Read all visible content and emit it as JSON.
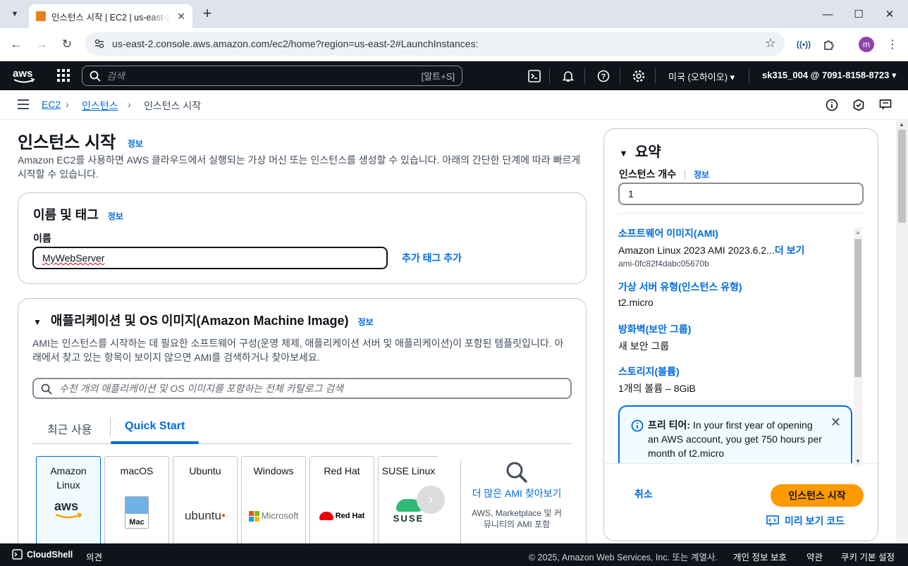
{
  "browser": {
    "tab_title": "인스턴스 시작 | EC2 | us-east-2",
    "url": "us-east-2.console.aws.amazon.com/ec2/home?region=us-east-2#LaunchInstances:",
    "profile_initial": "m"
  },
  "aws_nav": {
    "search_placeholder": "검색",
    "search_shortcut": "[알트+S]",
    "region": "미국 (오하이오) ▾",
    "account": "sk315_004 @ 7091-8158-8723 ▾"
  },
  "breadcrumb": {
    "items": [
      "EC2",
      "인스턴스",
      "인스턴스 시작"
    ]
  },
  "page": {
    "title": "인스턴스 시작",
    "info": "정보",
    "description": "Amazon EC2를 사용하면 AWS 클라우드에서 실행되는 가상 머신 또는 인스턴스를 생성할 수 있습니다. 아래의 간단한 단계에 따라 빠르게 시작할 수 있습니다."
  },
  "name_card": {
    "title": "이름 및 태그",
    "info": "정보",
    "label": "이름",
    "value": "MyWebServer",
    "add_tags": "추가 태그 추가"
  },
  "ami_card": {
    "title": "애플리케이션 및 OS 이미지(Amazon Machine Image)",
    "info": "정보",
    "description": "AMI는 인스턴스를 시작하는 데 필요한 소프트웨어 구성(운영 체제, 애플리케이션 서버 및 애플리케이션)이 포함된 템플릿입니다. 아래에서 찾고 있는 항목이 보이지 않으면 AMI를 검색하거나 찾아보세요.",
    "search_placeholder": "수천 개의 애플리케이션 및 OS 이미지를 포함하는 전체 카탈로그 검색",
    "tabs": [
      "최근 사용",
      "Quick Start"
    ],
    "os_tiles": [
      {
        "label": "Amazon Linux",
        "logo": "aws"
      },
      {
        "label": "macOS",
        "logo": "Mac"
      },
      {
        "label": "Ubuntu",
        "logo": "ubuntu"
      },
      {
        "label": "Windows",
        "logo": "Microsoft"
      },
      {
        "label": "Red Hat",
        "logo": "Red Hat"
      },
      {
        "label": "SUSE Linux",
        "logo": "SUSE"
      }
    ],
    "browse_more": "더 많은 AMI 찾아보기",
    "browse_sub": "AWS, Marketplace 및 커뮤니티의 AMI 포함"
  },
  "summary": {
    "title": "요약",
    "count_label": "인스턴스 개수",
    "info": "정보",
    "count_value": "1",
    "ami_title": "소프트웨어 이미지(AMI)",
    "ami_value": "Amazon Linux 2023 AMI 2023.6.2...",
    "ami_more": "더 보기",
    "ami_id": "ami-0fc82f4dabc05670b",
    "type_title": "가상 서버 유형(인스턴스 유형)",
    "type_value": "t2.micro",
    "fw_title": "방화벽(보안 그룹)",
    "fw_value": "새 보안 그룹",
    "storage_title": "스토리지(볼륨)",
    "storage_value": "1개의 볼륨 – 8GiB",
    "free_tier_label": "프리 티어:",
    "free_tier_text": "In your first year of opening an AWS account, you get 750 hours per month of t2.micro",
    "cancel": "취소",
    "launch": "인스턴스 시작",
    "preview": "미리 보기 코드"
  },
  "footer": {
    "cloudshell": "CloudShell",
    "feedback": "의견",
    "copyright": "© 2025, Amazon Web Services, Inc. 또는 계열사.",
    "privacy": "개인 정보 보호",
    "terms": "약관",
    "cookies": "쿠키 기본 설정"
  }
}
